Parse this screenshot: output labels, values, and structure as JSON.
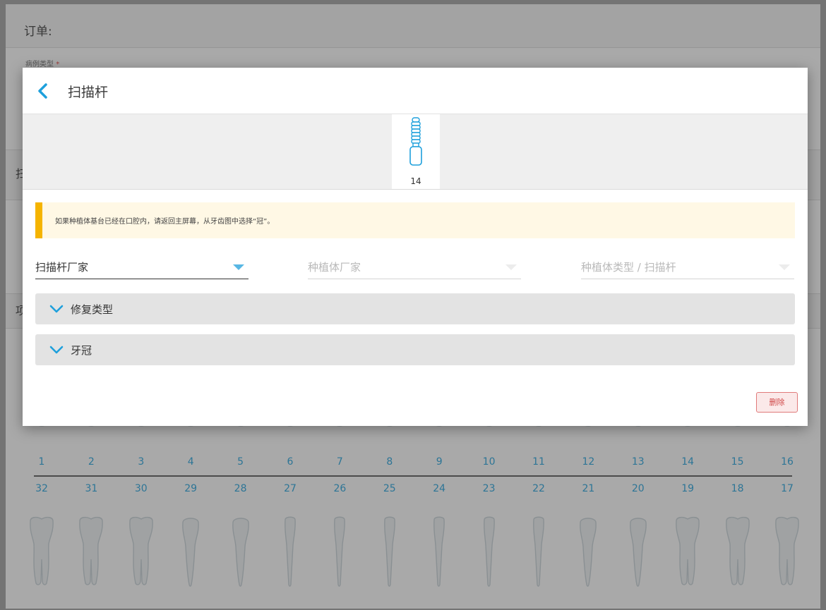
{
  "background": {
    "order_title": "订单:",
    "case_type_label": "病例类型",
    "required_mark": "*",
    "band2_letter": "扫",
    "band3_letter": "项",
    "upper_numbers": [
      "1",
      "2",
      "3",
      "4",
      "5",
      "6",
      "7",
      "8",
      "9",
      "10",
      "11",
      "12",
      "13",
      "14",
      "15",
      "16"
    ],
    "lower_numbers": [
      "32",
      "31",
      "30",
      "29",
      "28",
      "27",
      "26",
      "25",
      "24",
      "23",
      "22",
      "21",
      "20",
      "19",
      "18",
      "17"
    ]
  },
  "dialog": {
    "title": "扫描杆",
    "selected_tooth": "14",
    "alert_text": "如果种植体基台已经在口腔内，请返回主屏幕，从牙齿图中选择“冠”。",
    "fields": {
      "scanbody_manufacturer": "扫描杆厂家",
      "implant_manufacturer": "种植体厂家",
      "implant_type": "种植体类型 / 扫描杆"
    },
    "sections": {
      "restoration_type": "修复类型",
      "crown": "牙冠"
    },
    "delete_label": "删除"
  },
  "colors": {
    "accent": "#1ea0dc",
    "alert_bar": "#f5b400",
    "delete": "#d04848"
  },
  "icons": [
    "chevron-left-icon",
    "scanbody-icon",
    "caret-down-icon",
    "chevron-down-icon",
    "tooth-icon"
  ]
}
